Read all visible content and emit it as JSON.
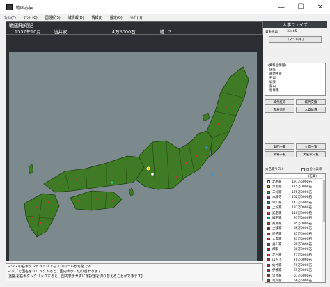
{
  "window": {
    "title": "戦国志伝",
    "controls": {
      "minimize": "—",
      "maximize": "☐",
      "close": "✕"
    }
  },
  "menu": [
    "ﾌｧｲﾙ(F)",
    "ｺﾏﾝﾄﾞ(C)",
    "国選択(S)",
    "城情報(D)",
    "情報(I)",
    "設定(O)",
    "ﾍﾙﾌﾟ(H)"
  ],
  "header": {
    "title": "戦国飛翔記",
    "date": "1557年10月",
    "clan": "浅井家",
    "koku": "4万8000石",
    "castles": "城　3"
  },
  "panel": {
    "phase": "人事フェイズ",
    "funds_label": "資金残高",
    "funds_value": "33465",
    "end_command": "コマンド終了",
    "list_heading": "<資料国情報>",
    "list_items": [
      "国名",
      "耕地生産",
      "石高",
      "城湊",
      "鉱山",
      "留易港"
    ],
    "buttons": {
      "b1": "城代任命",
      "b2": "城代交換",
      "b3": "客将追放",
      "b4": "人質処遇",
      "b5": "軍配一覧",
      "b6": "文官一覧",
      "b7": "武将一覧",
      "b8": "大名家一覧"
    },
    "daimyo_label": "大名家リスト",
    "sort_label": "由分け表示",
    "table_head": {
      "col1": "",
      "col2": "(石高)"
    },
    "daimyo": [
      {
        "name": "北条家",
        "koku": "197万5000石",
        "color": "#ffffff"
      },
      {
        "name": "六角家",
        "koku": "175万0000石",
        "color": "#f1c40f"
      },
      {
        "name": "三好家",
        "koku": "175万0000石",
        "color": "#2ecc71"
      },
      {
        "name": "本願寺",
        "koku": "162万0000石",
        "color": "#8e44ad"
      },
      {
        "name": "今川家",
        "koku": "147万5000石",
        "color": "#3498db"
      },
      {
        "name": "上杉家",
        "koku": "137万0000石",
        "color": "#c0392b"
      },
      {
        "name": "武田家",
        "koku": "110万0000石",
        "color": "#e74c3c"
      },
      {
        "name": "織田家",
        "koku": "97万0000石",
        "color": "#1abc9c"
      },
      {
        "name": "斎藤家",
        "koku": "95万0000石",
        "color": "#d35400"
      },
      {
        "name": "土岐家",
        "koku": "85万0000石",
        "color": "#922b21"
      },
      {
        "name": "尼子家",
        "koku": "85万0000石",
        "color": "#a93226"
      },
      {
        "name": "大友家",
        "koku": "81万5000石",
        "color": "#b03a2e"
      },
      {
        "name": "畠山家",
        "koku": "80万0000石",
        "color": "#c0392b"
      },
      {
        "name": "畑家",
        "koku": "80万0000石",
        "color": "#b71c1c"
      },
      {
        "name": "足利家",
        "koku": "77万5000石",
        "color": "#cb4335"
      },
      {
        "name": "山内上",
        "koku": "70万0000石",
        "color": "#a93226"
      },
      {
        "name": "佐竹家",
        "koku": "70万0000石",
        "color": "#c62828"
      },
      {
        "name": "伊達家",
        "koku": "69万0000石",
        "color": "#b03a2e"
      },
      {
        "name": "里見家",
        "koku": "67万5000石",
        "color": "#922b21"
      },
      {
        "name": "毛利家",
        "koku": "66万5000石",
        "color": "#c0392b"
      },
      {
        "name": "長宗家",
        "koku": "65万5000石",
        "color": "#b71c1c"
      }
    ]
  },
  "status": [
    "マウスの右ボタンドラッグでもスクロールが可能です",
    "マップで国名をクリックすると、国内表示に切り替わります",
    "[国名を右ボタンクリックすると、国内表示せずに選択国を切り替えることができます]"
  ],
  "colors": {
    "map_sea": "#7d8a8d",
    "land": "#3f7a24",
    "header_bg": "#2b2f34",
    "player": "#f1c40f"
  }
}
